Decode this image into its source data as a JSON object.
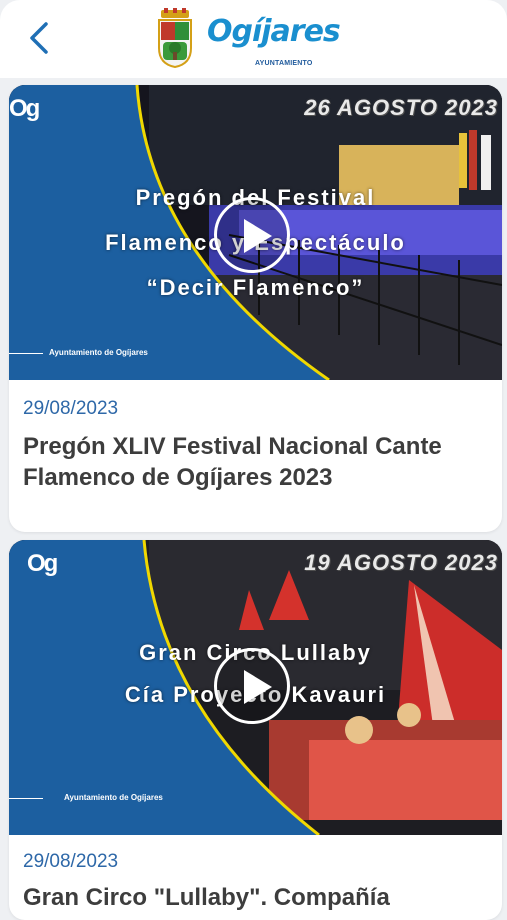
{
  "header": {
    "back_icon": "chevron-left-icon",
    "logo_text": "Ogíjares",
    "logo_subtext": "AYUNTAMIENTO"
  },
  "videos": [
    {
      "date_stamp": "26 AGOSTO 2023",
      "overlay_lines": [
        "Pregón del Festival",
        "Flamenco y Espectáculo",
        "“Decir Flamenco”"
      ],
      "ayuntamiento_label": "Ayuntamiento de Ogíjares",
      "play_icon": "play-icon",
      "date": "29/08/2023",
      "title": "Pregón XLIV Festival Nacional Cante Flamenco de Ogíjares 2023"
    },
    {
      "date_stamp": "19 AGOSTO 2023",
      "overlay_lines": [
        "Gran Circo Lullaby",
        "Cía Proyecto Kavauri"
      ],
      "ayuntamiento_label": "Ayuntamiento de Ogíjares",
      "play_icon": "play-icon",
      "date": "29/08/2023",
      "title": "Gran Circo \"Lullaby\". Compañía"
    }
  ],
  "colors": {
    "brand_blue": "#1a8fcf",
    "panel_blue": "#1c5fa0",
    "curve_yellow": "#f0d800",
    "date_blue": "#2e68a8",
    "title_gray": "#3d3d3d"
  }
}
